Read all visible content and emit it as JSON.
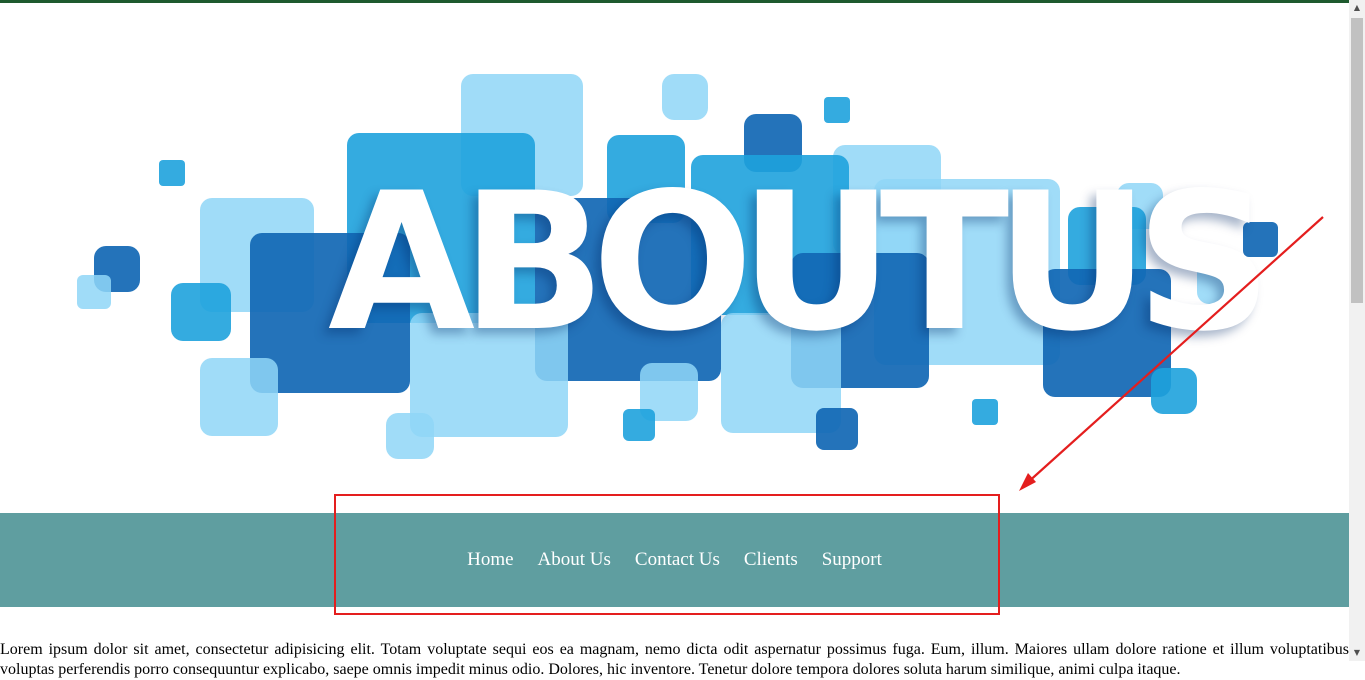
{
  "banner": {
    "text": "ABOUTUS",
    "colors": {
      "light": "#8fd6f7",
      "medium": "#1ea2dd",
      "dark": "#1167b4"
    }
  },
  "nav": {
    "background": "#5f9ea0",
    "items": [
      {
        "label": "Home"
      },
      {
        "label": "About Us"
      },
      {
        "label": "Contact Us"
      },
      {
        "label": "Clients"
      },
      {
        "label": "Support"
      }
    ]
  },
  "content": {
    "paragraph": "Lorem ipsum dolor sit amet, consectetur adipisicing elit. Totam voluptate sequi eos ea magnam, nemo dicta odit aspernatur possimus fuga. Eum, illum. Maiores ullam dolore ratione et illum voluptatibus voluptas perferendis porro consequuntur explicabo, saepe omnis impedit minus odio. Dolores, hic inventore. Tenetur dolore tempora dolores soluta harum similique, animi culpa itaque."
  },
  "annotation": {
    "color": "#e41e1e"
  },
  "scrollbar": {
    "up_icon": "triangle-up-icon",
    "down_icon": "triangle-down-icon"
  }
}
